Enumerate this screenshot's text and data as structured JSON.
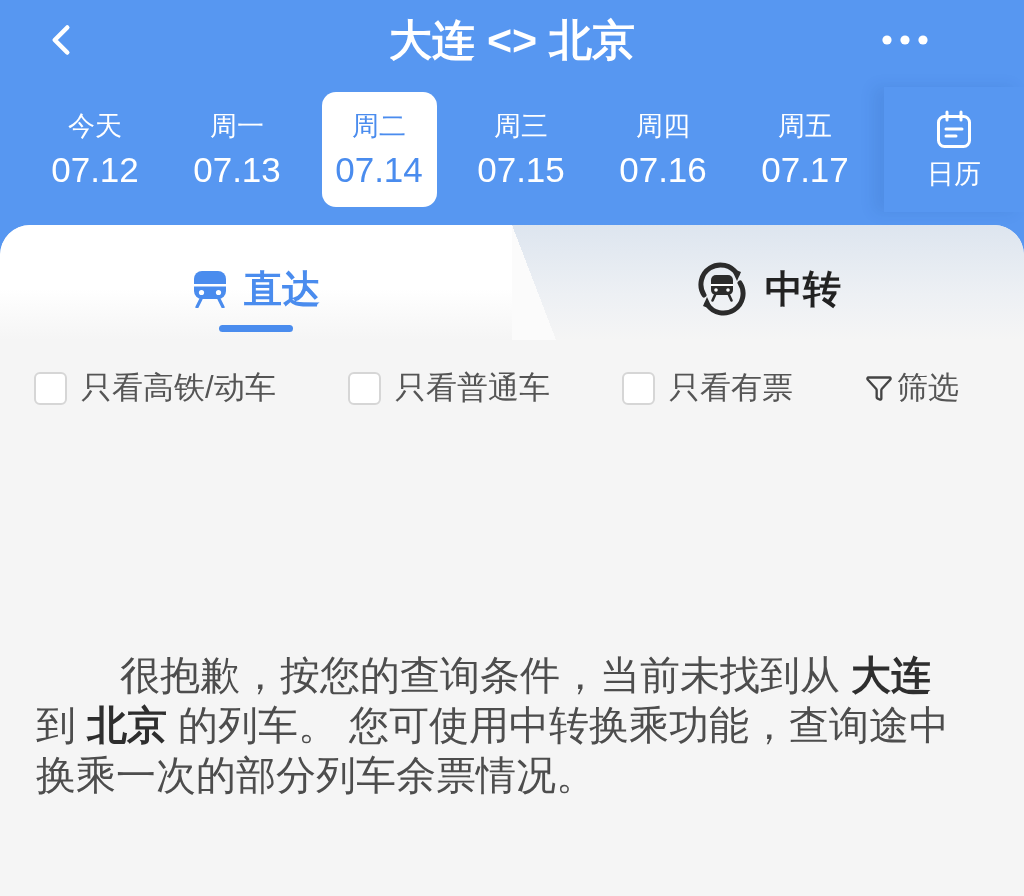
{
  "header": {
    "title": "大连 <> 北京"
  },
  "dates": [
    {
      "weekday": "今天",
      "date": "07.12",
      "selected": false
    },
    {
      "weekday": "周一",
      "date": "07.13",
      "selected": false
    },
    {
      "weekday": "周二",
      "date": "07.14",
      "selected": true
    },
    {
      "weekday": "周三",
      "date": "07.15",
      "selected": false
    },
    {
      "weekday": "周四",
      "date": "07.16",
      "selected": false
    },
    {
      "weekday": "周五",
      "date": "07.17",
      "selected": false
    }
  ],
  "calendar": {
    "label": "日历"
  },
  "mode_tabs": [
    {
      "kind": "direct",
      "label": "直达",
      "selected": true
    },
    {
      "kind": "transfer",
      "label": "中转",
      "selected": false
    }
  ],
  "filters": [
    {
      "label": "只看高铁/动车",
      "checked": false
    },
    {
      "label": "只看普通车",
      "checked": false
    },
    {
      "label": "只看有票",
      "checked": false
    }
  ],
  "filter_button": {
    "label": "筛选"
  },
  "message": "很抱歉，按您的查询条件，当前未找到从 **大连**到 **北京** 的列车。 您可使用中转换乘功能，查询途中换乘一次的部分列车余票情况。"
}
